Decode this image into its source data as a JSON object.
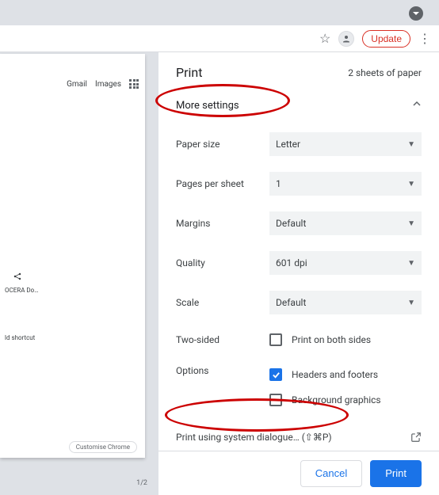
{
  "toolbar": {
    "update_label": "Update"
  },
  "preview": {
    "links": {
      "gmail": "Gmail",
      "images": "Images"
    },
    "tile1": "OCERA Do…",
    "tile2": "ld shortcut",
    "customise": "Customise Chrome",
    "page_counter": "1/2"
  },
  "panel": {
    "title": "Print",
    "sheets": "2 sheets of paper",
    "more_settings": "More settings",
    "rows": {
      "paper_size": {
        "label": "Paper size",
        "value": "Letter"
      },
      "pages_per_sheet": {
        "label": "Pages per sheet",
        "value": "1"
      },
      "margins": {
        "label": "Margins",
        "value": "Default"
      },
      "quality": {
        "label": "Quality",
        "value": "601 dpi"
      },
      "scale": {
        "label": "Scale",
        "value": "Default"
      },
      "two_sided": {
        "label": "Two-sided",
        "checkbox_label": "Print on both sides"
      },
      "options": {
        "label": "Options",
        "headers_footers": "Headers and footers",
        "background_graphics": "Background graphics"
      }
    },
    "system_dialog": "Print using system dialogue… (⇧⌘P)",
    "footer": {
      "cancel": "Cancel",
      "print": "Print"
    }
  }
}
